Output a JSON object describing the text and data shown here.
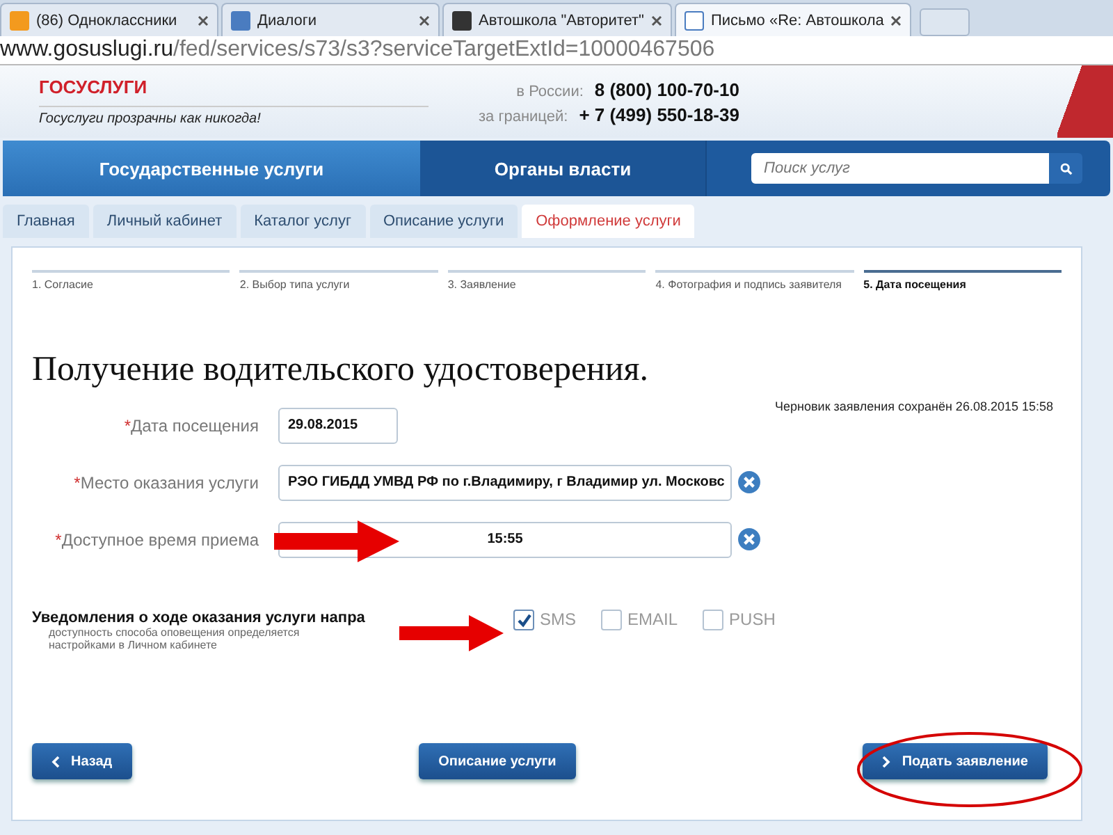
{
  "browser": {
    "tabs": [
      {
        "title": "(86) Одноклассники",
        "selected": false
      },
      {
        "title": "Диалоги",
        "selected": false
      },
      {
        "title": "Автошкола \"Авторитет\"",
        "selected": false
      },
      {
        "title": "Письмо «Re: Автошкола",
        "selected": true
      }
    ],
    "address": {
      "host": "www.gosuslugi.ru",
      "path": "/fed/services/s73/s3?serviceTargetExtId=10000467506"
    }
  },
  "header": {
    "logo_text": "ГОСУСЛУГИ",
    "slogan": "Госуслуги прозрачны как никогда!",
    "phones": [
      {
        "label": "в России:",
        "number": "8 (800) 100-70-10"
      },
      {
        "label": "за границей:",
        "number": "+ 7 (499) 550-18-39"
      }
    ]
  },
  "nav": {
    "items": [
      {
        "label": "Государственные услуги",
        "selected": true
      },
      {
        "label": "Органы власти",
        "selected": false
      }
    ],
    "search": {
      "placeholder": "Поиск услуг"
    }
  },
  "breadcrumbs": [
    {
      "label": "Главная",
      "selected": false
    },
    {
      "label": "Личный кабинет",
      "selected": false
    },
    {
      "label": "Каталог услуг",
      "selected": false
    },
    {
      "label": "Описание услуги",
      "selected": false
    },
    {
      "label": "Оформление услуги",
      "selected": true
    }
  ],
  "steps": [
    {
      "label": "1. Согласие",
      "selected": false
    },
    {
      "label": "2. Выбор типа услуги",
      "selected": false
    },
    {
      "label": "3. Заявление",
      "selected": false
    },
    {
      "label": "4. Фотография и подпись заявителя",
      "selected": false
    },
    {
      "label": "5. Дата посещения",
      "selected": true
    }
  ],
  "title": "Получение водительского удостоверения.",
  "draft_note": "Черновик заявления сохранён 26.08.2015 15:58",
  "fields": [
    {
      "required_mark": "*",
      "label": "Дата посещения",
      "value": "29.08.2015",
      "kind": "short",
      "clearable": false
    },
    {
      "required_mark": "*",
      "label": "Место оказания услуги",
      "value": "РЭО ГИБДД УМВД РФ по г.Владимиру,  г Владимир ул. Московс",
      "kind": "wide",
      "clearable": true
    },
    {
      "required_mark": "*",
      "label": "Доступное время приема",
      "value": "15:55",
      "kind": "center",
      "clearable": true
    }
  ],
  "notifications": {
    "heading": "Уведомления о ходе оказания услуги напра",
    "hint": "доступность способа оповещения определяется настройками в Личном кабинете",
    "options": [
      {
        "label": "SMS",
        "checked": true
      },
      {
        "label": "EMAIL",
        "checked": false
      },
      {
        "label": "PUSH",
        "checked": false
      }
    ]
  },
  "buttons": [
    {
      "label": "Назад",
      "kind": "back"
    },
    {
      "label": "Описание услуги",
      "kind": "plain"
    },
    {
      "label": "Подать заявление",
      "kind": "next"
    }
  ]
}
